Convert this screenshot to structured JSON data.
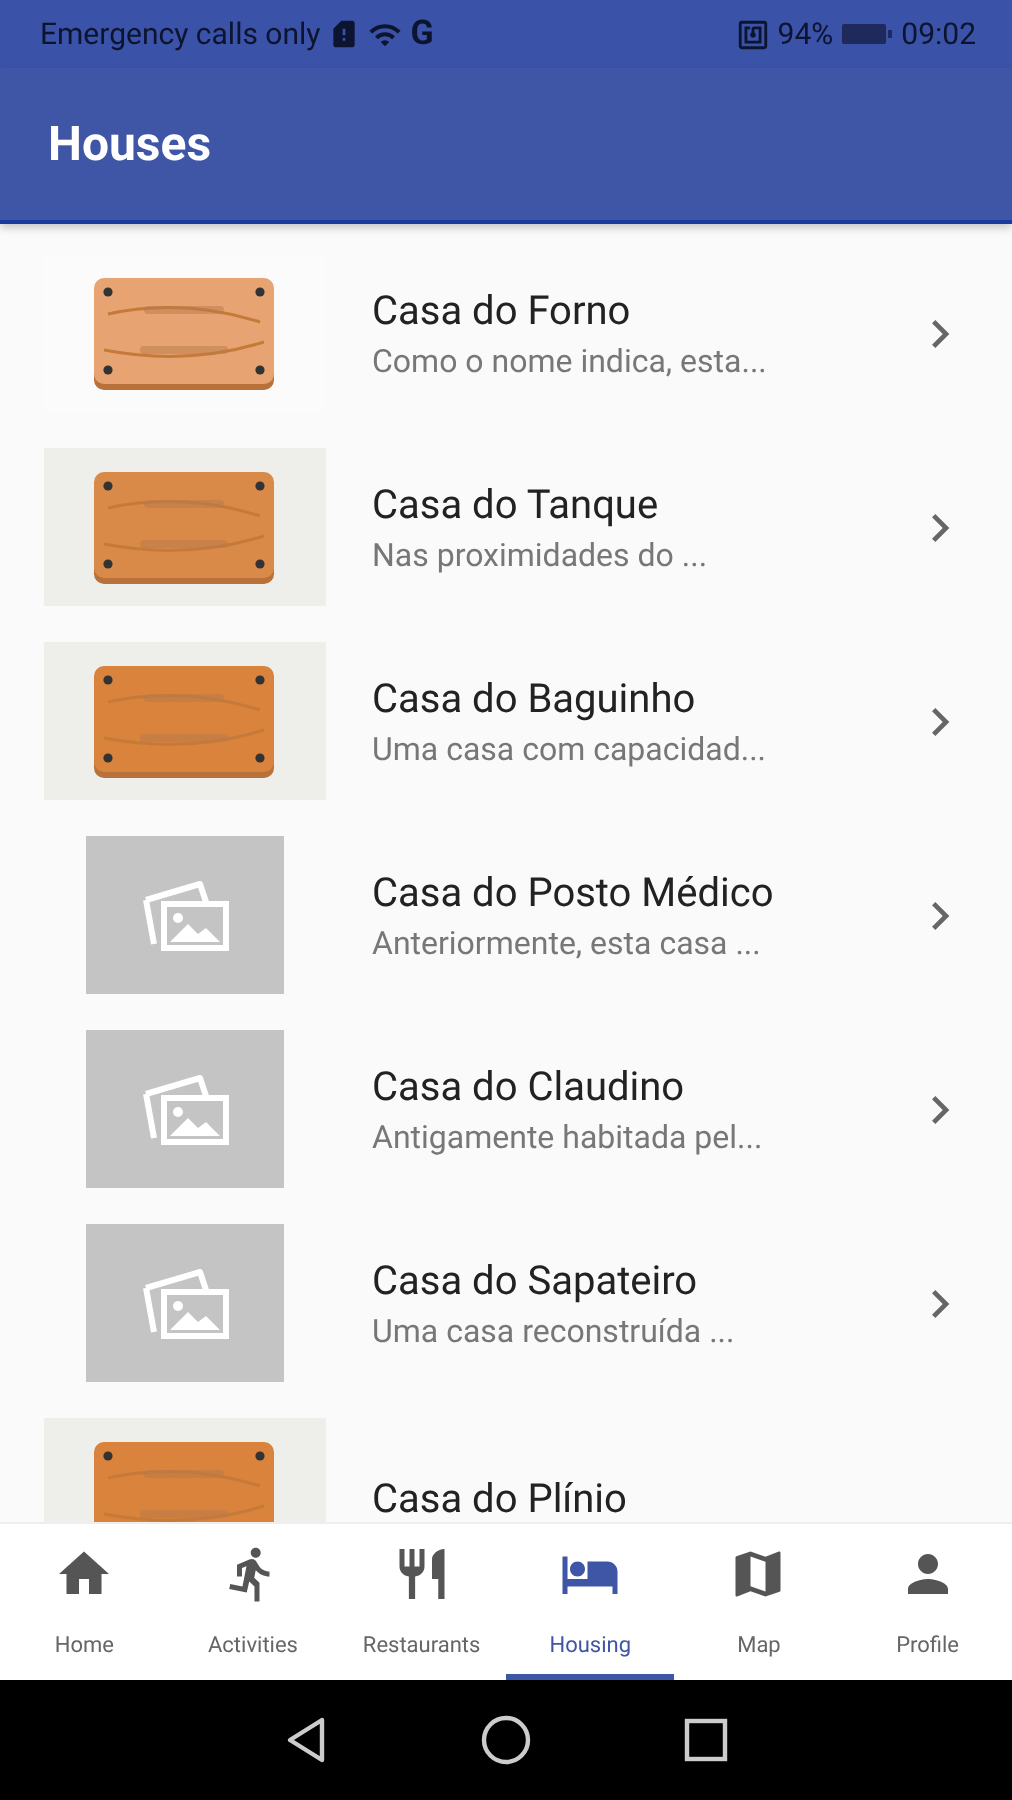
{
  "status_bar": {
    "carrier": "Emergency calls only",
    "network": "G",
    "battery": "94%",
    "time": "09:02"
  },
  "app_bar": {
    "title": "Houses"
  },
  "houses": [
    {
      "title": "Casa do Forno",
      "description": "Como o nome indica, esta..."
    },
    {
      "title": "Casa do Tanque",
      "description": "Nas proximidades do ..."
    },
    {
      "title": "Casa do Baguinho",
      "description": "Uma casa com capacidad..."
    },
    {
      "title": "Casa do Posto Médico",
      "description": "Anteriormente, esta casa ...",
      "image": {
        "kind": "placeholder"
      }
    },
    {
      "title": "Casa do Claudino",
      "description": "Antigamente habitada pel...",
      "image": {
        "kind": "placeholder"
      }
    },
    {
      "title": "Casa do Sapateiro",
      "description": "Uma casa reconstruída ...",
      "image": {
        "kind": "placeholder"
      }
    },
    {
      "title": "Casa do Plínio"
    }
  ],
  "bottom_nav": [
    {
      "label": "Home",
      "selected": false
    },
    {
      "label": "Activities",
      "selected": false
    },
    {
      "label": "Restaurants",
      "selected": false
    },
    {
      "label": "Housing",
      "selected": true
    },
    {
      "label": "Map",
      "selected": false
    },
    {
      "label": "Profile",
      "selected": false
    }
  ]
}
